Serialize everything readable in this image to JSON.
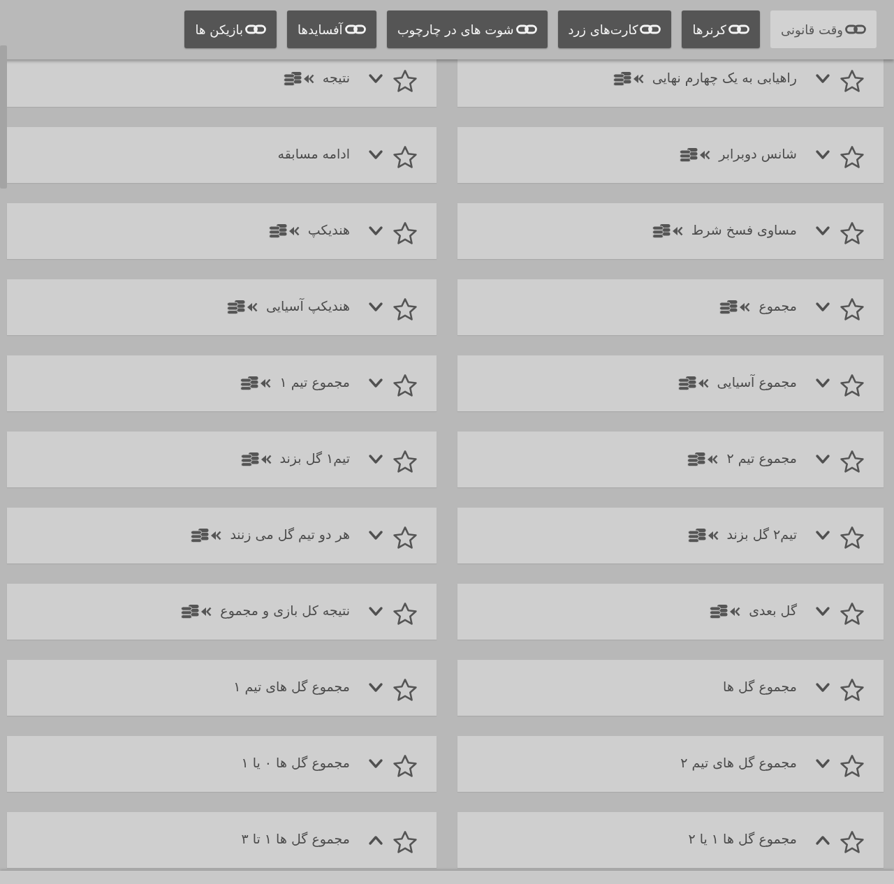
{
  "tabs": [
    {
      "label": "وقت قانونی",
      "selected": true
    },
    {
      "label": "کرنرها",
      "selected": false
    },
    {
      "label": "کارت‌های زرد",
      "selected": false
    },
    {
      "label": "شوت های در چارچوب",
      "selected": false
    },
    {
      "label": "آفسایدها",
      "selected": false
    },
    {
      "label": "بازیکن ها",
      "selected": false
    }
  ],
  "markets": [
    {
      "label": "راهیابی به یک چهارم نهایی",
      "favorite": false,
      "expanded": false,
      "coins": true
    },
    {
      "label": "نتیجه",
      "favorite": false,
      "expanded": false,
      "coins": true
    },
    {
      "label": "شانس دوبرابر",
      "favorite": false,
      "expanded": false,
      "coins": true
    },
    {
      "label": "ادامه مسابقه",
      "favorite": false,
      "expanded": false,
      "coins": false
    },
    {
      "label": "مساوی فسخ شرط",
      "favorite": false,
      "expanded": false,
      "coins": true
    },
    {
      "label": "هندیکپ",
      "favorite": false,
      "expanded": false,
      "coins": true
    },
    {
      "label": "مجموع",
      "favorite": false,
      "expanded": false,
      "coins": true
    },
    {
      "label": "هندیکپ آسیایی",
      "favorite": false,
      "expanded": false,
      "coins": true
    },
    {
      "label": "مجموع آسیایی",
      "favorite": false,
      "expanded": false,
      "coins": true
    },
    {
      "label": "مجموع تیم ۱",
      "favorite": false,
      "expanded": false,
      "coins": true
    },
    {
      "label": "مجموع تیم ۲",
      "favorite": false,
      "expanded": false,
      "coins": true
    },
    {
      "label": "تیم۱ گل بزند",
      "favorite": false,
      "expanded": false,
      "coins": true
    },
    {
      "label": "تیم۲ گل بزند",
      "favorite": false,
      "expanded": false,
      "coins": true
    },
    {
      "label": "هر دو تیم گل می زنند",
      "favorite": false,
      "expanded": false,
      "coins": true
    },
    {
      "label": "گل بعدی",
      "favorite": false,
      "expanded": false,
      "coins": true
    },
    {
      "label": "نتیجه کل بازی و مجموع",
      "favorite": false,
      "expanded": false,
      "coins": true
    },
    {
      "label": "مجموع گل ها",
      "favorite": false,
      "expanded": false,
      "coins": false
    },
    {
      "label": "مجموع گل های تیم ۱",
      "favorite": false,
      "expanded": false,
      "coins": false
    },
    {
      "label": "مجموع گل های تیم ۲",
      "favorite": false,
      "expanded": false,
      "coins": false
    },
    {
      "label": "مجموع گل ها ۰ یا ۱",
      "favorite": false,
      "expanded": false,
      "coins": false
    },
    {
      "label": "مجموع گل ها ۱ یا ۲",
      "favorite": false,
      "expanded": true,
      "coins": false
    },
    {
      "label": "مجموع گل ها ۱ تا ۳",
      "favorite": false,
      "expanded": true,
      "coins": false
    }
  ]
}
